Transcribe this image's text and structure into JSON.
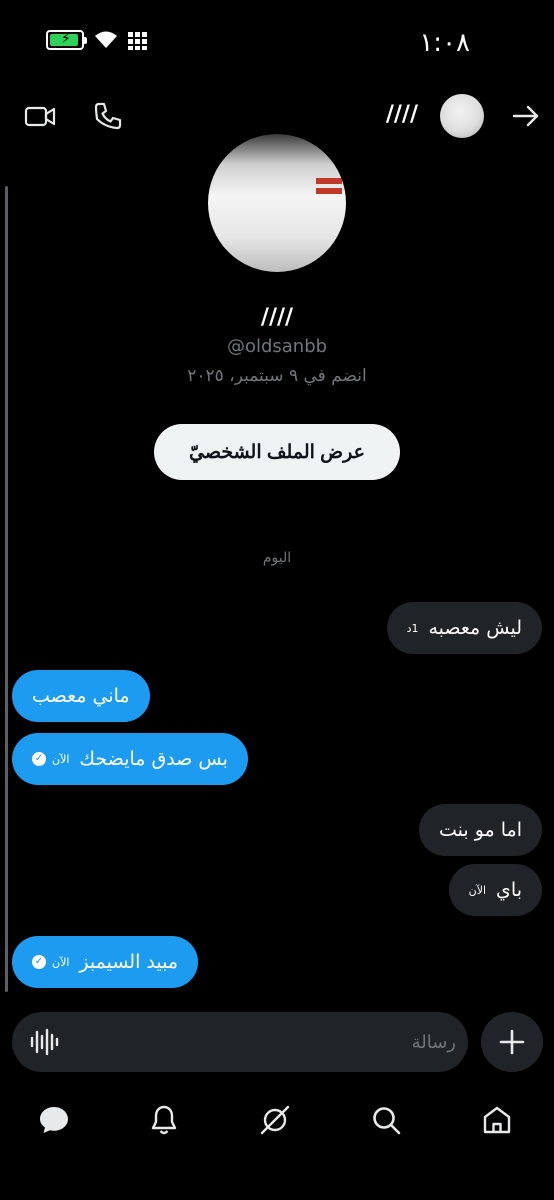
{
  "status_bar": {
    "time": "١:٠٨",
    "icons": [
      "battery-charging-icon",
      "wifi-icon",
      "signal-icon"
    ],
    "battery_color": "#2fd158"
  },
  "header": {
    "contact_name": "////",
    "icons": [
      "back-arrow-icon",
      "phone-icon",
      "video-call-icon"
    ]
  },
  "profile": {
    "name": "////",
    "handle": "@oldsanbb",
    "joined": "انضم في ٩ سبتمبر، ٢٠٢٥",
    "view_profile_label": "عرض الملف الشخصيّ"
  },
  "conversation": {
    "day_label": "اليوم",
    "messages": [
      {
        "direction": "received",
        "text": "ليش معصبه",
        "time": "1د"
      },
      {
        "direction": "sent",
        "text": "ماني معصب",
        "time": ""
      },
      {
        "direction": "sent",
        "text": "بس صدق مايضحك",
        "time": "الآن",
        "status": "read"
      },
      {
        "direction": "received",
        "text": "اما مو بنت",
        "time": ""
      },
      {
        "direction": "received",
        "text": "باي",
        "time": "الآن"
      },
      {
        "direction": "sent",
        "text": "مبيد السيمبز",
        "time": "الآن",
        "status": "read"
      }
    ]
  },
  "composer": {
    "placeholder": "رسالة",
    "value": ""
  },
  "bottom_nav": {
    "items": [
      "home-icon",
      "search-icon",
      "grok-icon",
      "notifications-icon",
      "messages-icon"
    ],
    "active": "messages-icon"
  },
  "colors": {
    "background": "#000000",
    "sent_bubble": "#1d9bf0",
    "received_bubble": "#202327",
    "secondary_text": "#71767b"
  }
}
